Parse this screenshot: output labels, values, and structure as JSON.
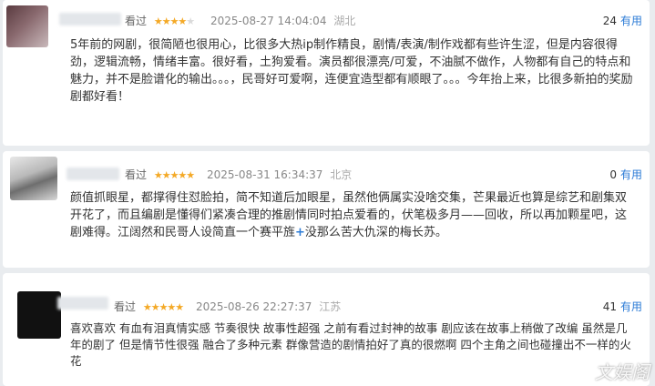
{
  "comments": [
    {
      "status": "看过",
      "stars": 4,
      "time": "2025-08-27 14:04:04",
      "location": "湖北",
      "useful_count": "24",
      "useful_label": "有用",
      "text": "5年前的网剧，很简陋也很用心，比很多大热ip制作精良，剧情/表演/制作戏都有些许生涩，但是内容很得劲，逻辑流畅，情绪丰富。很好看，土狗爱看。演员都很漂亮/可爱，不油腻不做作，人物都有自己的特点和魅力，并不是脸谱化的输出。。。，民哥好可爱啊，连便宜造型都有顺眼了。。。今年抬上来，比很多新拍的奖励剧都好看！"
    },
    {
      "status": "看过",
      "stars": 5,
      "time": "2025-08-31 16:34:37",
      "location": "北京",
      "useful_count": "0",
      "useful_label": "有用",
      "text_before": "颜值抓眼星，都撑得住怼脸拍，简不知道后加眼星，虽然他俩属实没啥交集，芒果最近也算是综艺和剧集双开花了，而且编剧是懂得们紧凑合理的推剧情同时拍点爱看的，伏笔极多月——回收，所以再加颗星吧，这剧难得。江阔然和民哥人设简直一个赛平旌",
      "plus": "+",
      "text_after": "没那么苦大仇深的梅长苏。"
    },
    {
      "status": "看过",
      "stars": 5,
      "time": "2025-08-26 22:27:37",
      "location": "江苏",
      "useful_count": "41",
      "useful_label": "有用",
      "text": "喜欢喜欢 有血有泪真情实感 节奏很快 故事性超强 之前有看过封神的故事 剧应该在故事上稍做了改编 虽然是几年的剧了 但是情节性很强 融合了多种元素 群像营造的剧情拍好了真的很燃啊 四个主角之间也碰撞出不一样的火花"
    }
  ],
  "watermark": "文娱阁",
  "colors": {
    "star": "#f4a926",
    "useful": "#2b7bd6"
  },
  "icons": {
    "star": "star-icon",
    "avatar": "avatar-image"
  }
}
